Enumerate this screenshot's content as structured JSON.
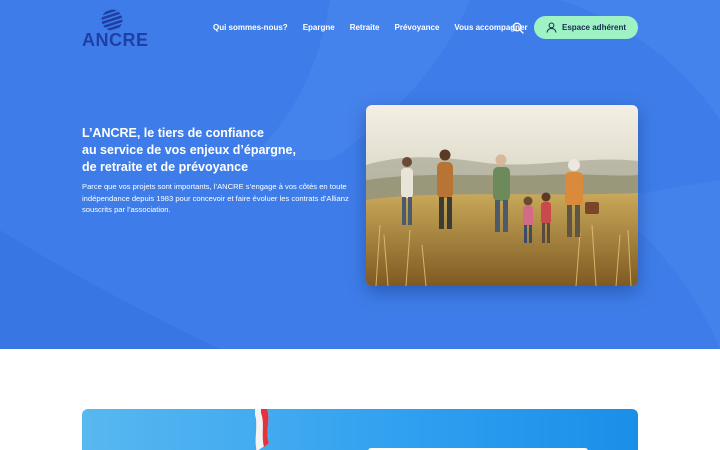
{
  "brand": {
    "name": "ANCRE",
    "logo_icon": "globe-stripes-icon",
    "color_primary": "#1f3fa6",
    "color_hero_bg": "#3e7de9",
    "color_accent": "#9ff2c4"
  },
  "nav": {
    "items": [
      {
        "label": "Qui sommes-nous?"
      },
      {
        "label": "Epargne"
      },
      {
        "label": "Retraite"
      },
      {
        "label": "Prévoyance"
      },
      {
        "label": "Vous accompagner"
      }
    ],
    "search_icon": "search-icon",
    "member_button": {
      "label": "Espace adhérent",
      "icon": "user-icon"
    }
  },
  "hero": {
    "title_lines": [
      "L’ANCRE, le tiers de confiance",
      "au service de vos enjeux d’épargne,",
      "de retraite et de prévoyance"
    ],
    "body": "Parce que vos projets sont importants, l’ANCRE s’engage à vos côtés en toute indépendance depuis 1983 pour concevoir et faire évoluer les contrats d’Allianz souscrits par l’association."
  }
}
